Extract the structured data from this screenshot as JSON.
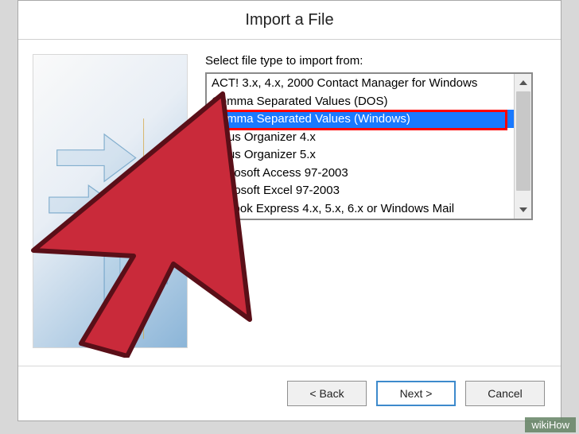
{
  "dialog": {
    "title": "Import a File",
    "prompt": "Select file type to import from:",
    "file_types": [
      "ACT! 3.x, 4.x, 2000 Contact Manager for Windows",
      "Comma Separated Values (DOS)",
      "Comma Separated Values (Windows)",
      "Lotus Organizer 4.x",
      "Lotus Organizer 5.x",
      "Microsoft Access 97-2003",
      "Microsoft Excel 97-2003",
      "Outlook Express 4.x, 5.x, 6.x or Windows Mail"
    ],
    "selected_index": 2,
    "buttons": {
      "back": "< Back",
      "next": "Next >",
      "cancel": "Cancel"
    }
  },
  "watermark": "wikiHow"
}
